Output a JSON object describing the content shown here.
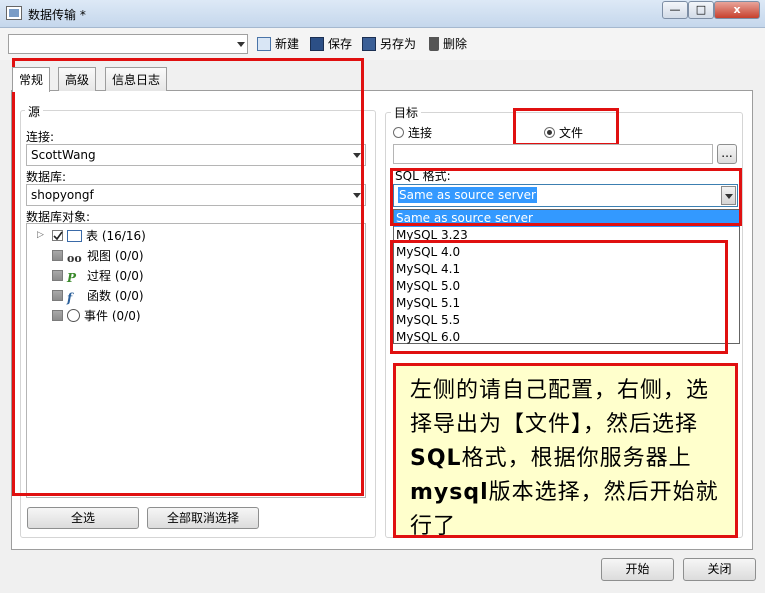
{
  "window": {
    "title": "数据传输 *",
    "controls": {
      "minimize": "—",
      "maximize": "□",
      "close": "x"
    }
  },
  "toolbar": {
    "profile_value": "",
    "new_label": "新建",
    "save_label": "保存",
    "save_as_label": "另存为",
    "delete_label": "删除"
  },
  "tabs": [
    {
      "label": "常规"
    },
    {
      "label": "高级"
    },
    {
      "label": "信息日志"
    }
  ],
  "source": {
    "title": "源",
    "connection_label": "连接:",
    "connection_value": "ScottWang",
    "database_label": "数据库:",
    "database_value": "shopyongf",
    "objects_label": "数据库对象:",
    "objects": [
      {
        "name": "表",
        "count": "(16/16)",
        "icon": "table-icon"
      },
      {
        "name": "视图",
        "count": "(0/0)",
        "icon": "view-icon"
      },
      {
        "name": "过程",
        "count": "(0/0)",
        "icon": "procedure-icon"
      },
      {
        "name": "函数",
        "count": "(0/0)",
        "icon": "function-icon"
      },
      {
        "name": "事件",
        "count": "(0/0)",
        "icon": "event-icon"
      }
    ],
    "select_all_label": "全选",
    "deselect_all_label": "全部取消选择"
  },
  "target": {
    "title": "目标",
    "connection_radio": "连接",
    "file_radio": "文件",
    "file_path": "",
    "browse_label": "...",
    "sql_format_label": "SQL 格式:",
    "sql_format_value": "Same as source server",
    "sql_format_options": [
      "Same as source server",
      "MySQL 3.23",
      "MySQL 4.0",
      "MySQL 4.1",
      "MySQL 5.0",
      "MySQL 5.1",
      "MySQL 5.5",
      "MySQL 6.0"
    ]
  },
  "annotation": {
    "part1": "左侧的请自己配置，右侧，选择导出为【文件】，然后选择",
    "bold1": "SQL",
    "part2": "格式，根据你服务器上",
    "bold2": "mysql",
    "part3": "版本选择，然后开始就行了"
  },
  "footer": {
    "start_label": "开始",
    "close_label": "关闭"
  },
  "colors": {
    "highlight": "#3399ff",
    "annotation_border": "#e01010",
    "annotation_bg": "#ffffcc"
  }
}
